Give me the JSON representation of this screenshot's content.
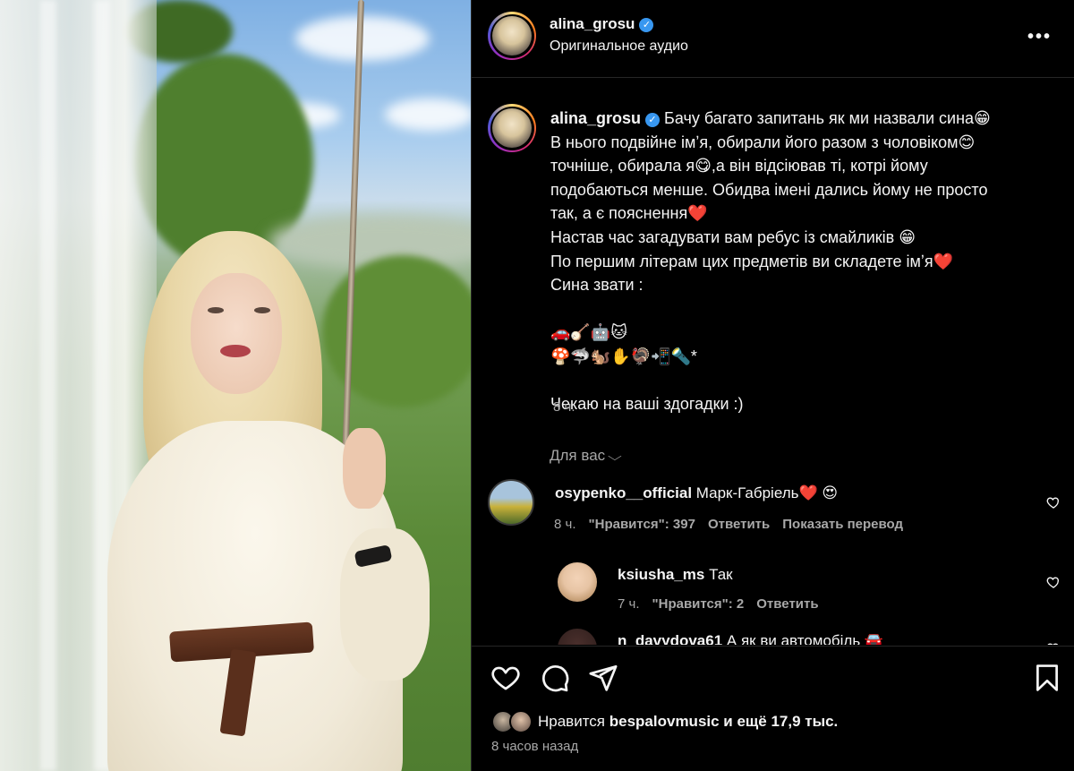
{
  "colors": {
    "background": "#000000",
    "text": "#f5f5f5",
    "secondary": "#a8a8a8",
    "verified": "#3897f0",
    "divider": "#262626"
  },
  "header": {
    "username": "alina_grosu",
    "verified_mark": "✓",
    "subtitle": "Оригинальное аудио",
    "more_icon": "•••"
  },
  "caption": {
    "username": "alina_grosu",
    "text": " Бачу багато запитань як ми назвали сина😁\nВ нього подвійне імʼя, обирали його разом з чоловіком😊\nточніше, обирала я😋,а він відсіював ті, котрі йому\nподобаються менше. Обидва імені дались йому не просто\nтак, а є пояснення❤️\nНастав час загадувати вам ребус із смайликів 😁\nПо першим літерам цих предметів ви складете імʼя❤️\nСина звати :\n\n🚗🪕🤖🐱\n🍄🦈🐿️✋🦃📲🔦*\n\nЧекаю на ваші здогадки :)",
    "time": "8 ч."
  },
  "for_you": {
    "label": "Для вас",
    "chevron": "⌵"
  },
  "comments": [
    {
      "username": "osypenko__official",
      "text": " Марк-Габріель❤️ 😍",
      "time": "8 ч.",
      "likes": "\"Нравится\": 397",
      "reply": "Ответить",
      "translate": "Показать перевод"
    },
    {
      "username": "ksiusha_ms",
      "text": " Так",
      "time": "7 ч.",
      "likes": "\"Нравится\": 2",
      "reply": "Ответить"
    },
    {
      "username": "n_davydova61",
      "text": " А як ви автомобіль 🚘"
    }
  ],
  "actions": {
    "like_icon": "heart-icon",
    "comment_icon": "comment-icon",
    "share_icon": "share-icon",
    "save_icon": "bookmark-icon"
  },
  "likes": {
    "prefix": "Нравится ",
    "user": "bespalovmusic",
    "suffix": " и ещё 17,9 тыс."
  },
  "posted_ago": "8 часов назад"
}
